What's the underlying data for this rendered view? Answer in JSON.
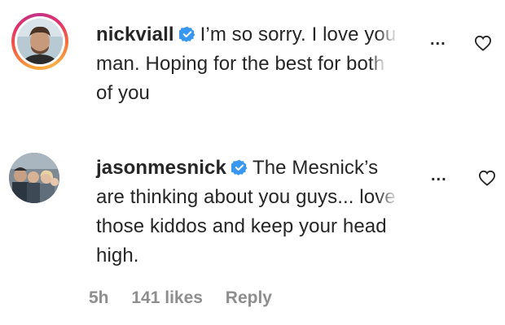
{
  "comments": [
    {
      "username": "nickviall",
      "verified": true,
      "text_visible": "I’m so sorry. I love y",
      "text_faded": "ou",
      "text_line2_visible": "man. Hoping for the best for bo",
      "text_line2_faded": "th",
      "text_line3": "of you",
      "more_label": "...",
      "like_icon": "heart-outline-icon",
      "avatar_ring": true
    },
    {
      "username": "jasonmesnick",
      "verified": true,
      "text_line1": "The Mesnick’s",
      "text_line2_visible": "are thinking about you guys... lo",
      "text_line2_faded": "ve",
      "text_line3": "those kiddos and keep your head",
      "text_line4": "high.",
      "more_label": "...",
      "like_icon": "heart-outline-icon",
      "time": "5h",
      "likes": "141 likes",
      "reply_label": "Reply"
    }
  ],
  "colors": {
    "text": "#262626",
    "meta": "#8e8e8e",
    "verified_badge": "#3897f0",
    "ring_gradient": [
      "#f9a03c",
      "#e1306c",
      "#c13584"
    ]
  }
}
